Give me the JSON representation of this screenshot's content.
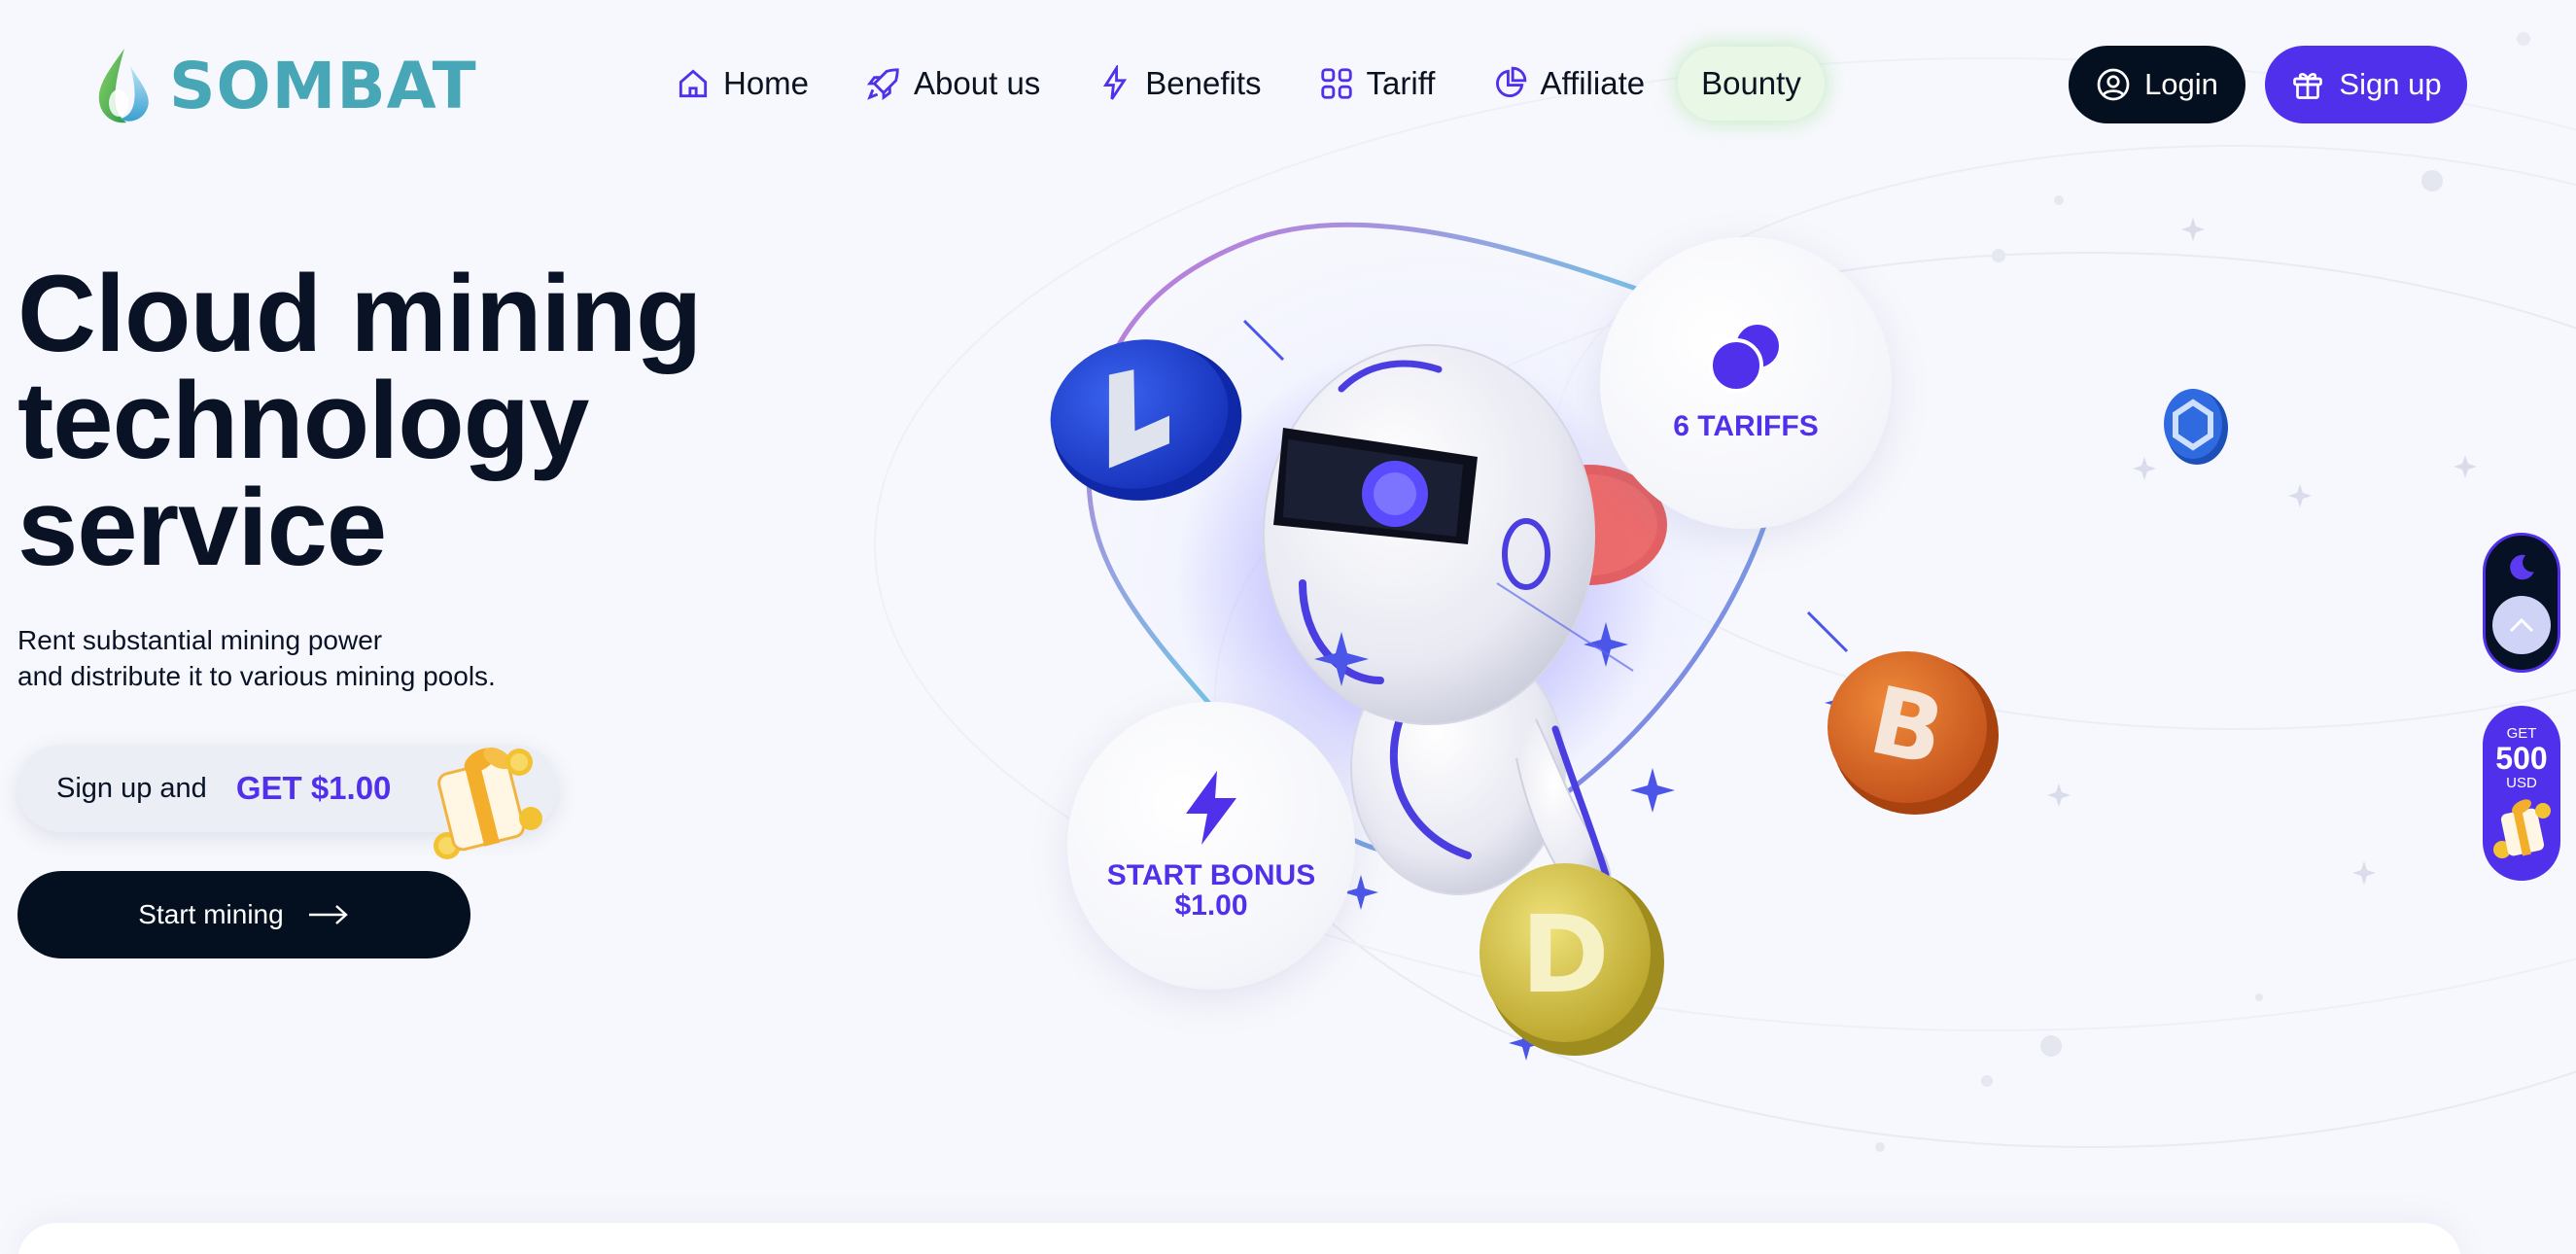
{
  "brand": {
    "name": "SOMBAT",
    "color": "#47a7b6"
  },
  "nav": {
    "items": [
      {
        "label": "Home",
        "icon": "home-icon"
      },
      {
        "label": "About us",
        "icon": "rocket-icon"
      },
      {
        "label": "Benefits",
        "icon": "lightning-icon"
      },
      {
        "label": "Tariff",
        "icon": "grid-icon"
      },
      {
        "label": "Affiliate",
        "icon": "pie-chart-icon"
      },
      {
        "label": "Bounty",
        "icon": ""
      }
    ]
  },
  "auth": {
    "login_label": "Login",
    "signup_label": "Sign up"
  },
  "hero": {
    "title_line1": "Cloud mining",
    "title_line2": "technology",
    "title_line3": "service",
    "subtitle_line1": "Rent substantial mining power",
    "subtitle_line2": "and distribute it to various mining pools.",
    "bonus_prefix": "Sign up and",
    "bonus_amount": "GET $1.00",
    "cta_label": "Start mining"
  },
  "illustration": {
    "tariffs_label": "6 TARIFFS",
    "start_bonus_line1": "START BONUS",
    "start_bonus_line2": "$1.00",
    "coins": [
      "litecoin",
      "bitcoin",
      "dogecoin",
      "chainlink",
      "tron"
    ]
  },
  "side": {
    "promo_get": "GET",
    "promo_amount": "500",
    "promo_unit": "USD"
  },
  "colors": {
    "accent": "#5030ea",
    "dark": "#04101f",
    "background": "#f7f8fd",
    "bounty_glow": "#e9f7e6"
  }
}
